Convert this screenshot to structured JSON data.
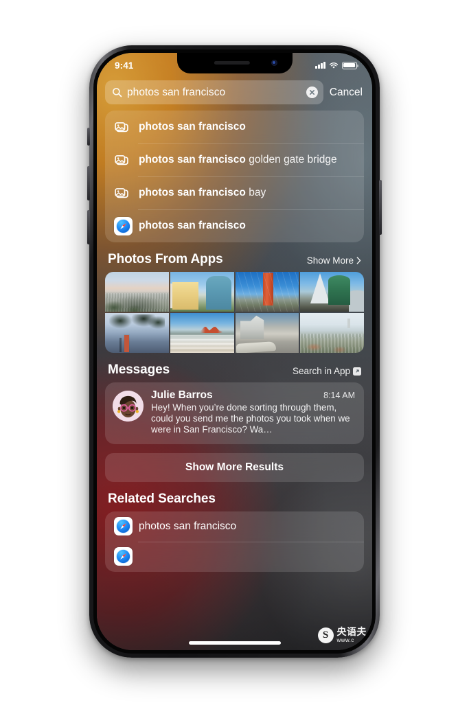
{
  "status_bar": {
    "time": "9:41",
    "cellular_icon": "cellular-signal-icon",
    "wifi_icon": "wifi-icon",
    "battery_icon": "battery-icon"
  },
  "search": {
    "icon": "magnifying-glass-icon",
    "value": "photos san francisco",
    "placeholder": "Search",
    "clear_icon": "clear-circle-icon",
    "cancel_label": "Cancel"
  },
  "suggestions": [
    {
      "icon": "photos-stack-icon",
      "bold": "photos san francisco",
      "rest": ""
    },
    {
      "icon": "photos-stack-icon",
      "bold": "photos san francisco",
      "rest": " golden gate bridge"
    },
    {
      "icon": "photos-stack-icon",
      "bold": "photos san francisco",
      "rest": " bay"
    },
    {
      "icon": "safari-icon",
      "bold": "photos san francisco",
      "rest": ""
    }
  ],
  "photos_section": {
    "title": "Photos From Apps",
    "action_label": "Show More",
    "action_icon": "chevron-right-icon",
    "photos": [
      {
        "alt": "San Francisco hillside neighborhood overlook at dusk"
      },
      {
        "alt": "Painted Ladies Victorian houses"
      },
      {
        "alt": "Golden Gate Bridge north tower against blue sky"
      },
      {
        "alt": "Transamerica Pyramid and green Columbus Tower"
      },
      {
        "alt": "Cypress trees with Golden Gate Bridge behind at dusk"
      },
      {
        "alt": "Baker Beach surf with Golden Gate Bridge"
      },
      {
        "alt": "Steep San Francisco street with parked cars"
      },
      {
        "alt": "Foggy aerial city view with Sutro Tower"
      }
    ]
  },
  "messages_section": {
    "title": "Messages",
    "action_label": "Search in App",
    "action_icon": "external-link-icon",
    "message": {
      "avatar_icon": "memoji-avatar",
      "sender": "Julie Barros",
      "time": "8:14 AM",
      "preview": "Hey! When you’re done sorting through them, could you send me the photos you took when we were in San Francisco? Wa…"
    }
  },
  "show_more_results": {
    "label": "Show More Results"
  },
  "related_section": {
    "title": "Related Searches",
    "items": [
      {
        "icon": "safari-icon",
        "label": "photos san francisco"
      },
      {
        "icon": "safari-icon",
        "label": ""
      }
    ]
  },
  "home_indicator": "home-indicator",
  "watermark": {
    "mark": "S",
    "name": "央语夫",
    "url": "www.c"
  },
  "colors": {
    "accent_orange": "#e79221",
    "accent_red": "#b62226",
    "safari_blue": "#1f8bf5",
    "text_primary": "#ffffff"
  }
}
